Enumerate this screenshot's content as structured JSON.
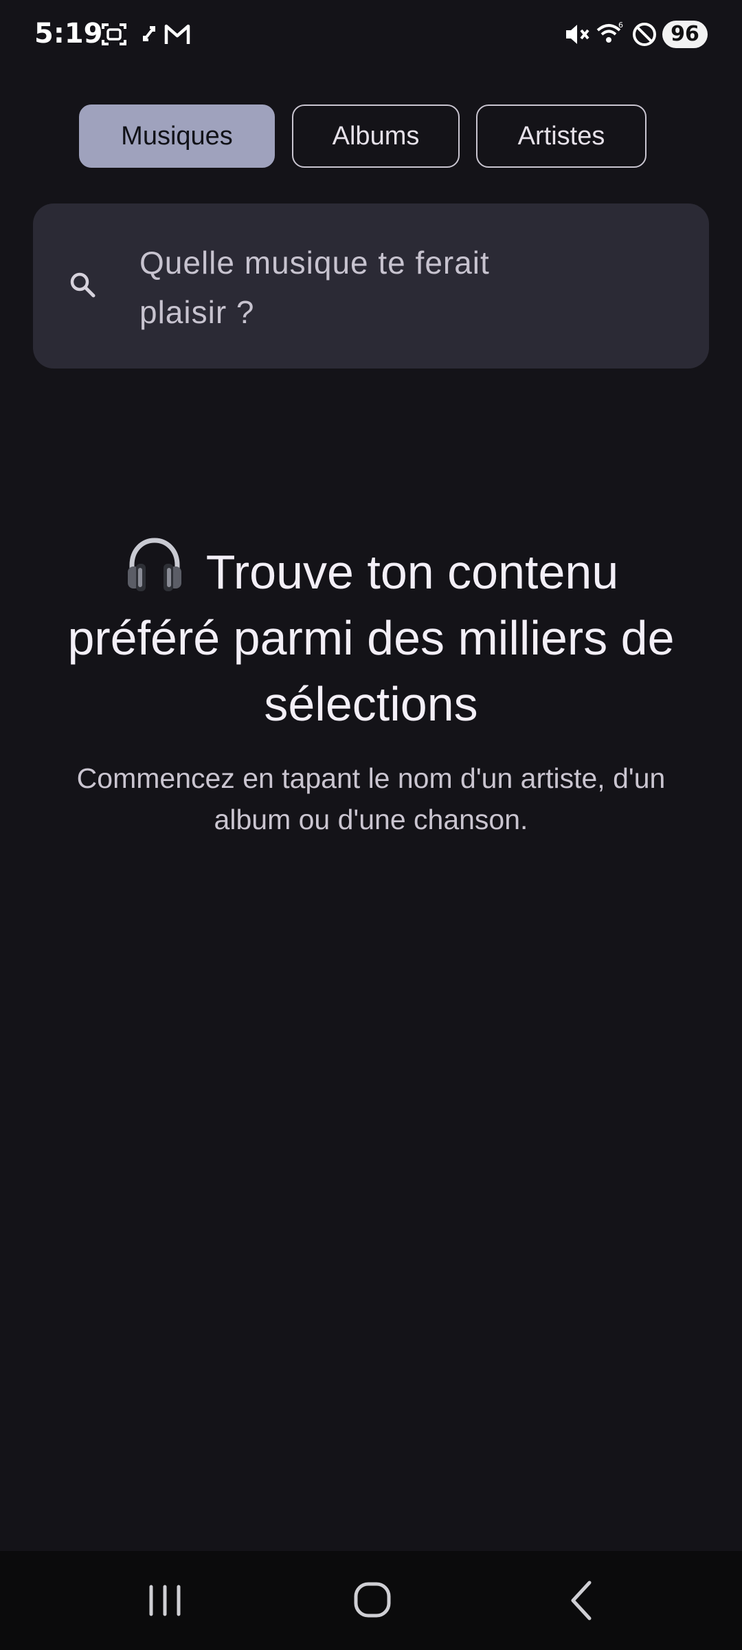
{
  "status_bar": {
    "time": "5:19",
    "battery": "96",
    "icons": [
      "screenshot-icon",
      "sync-icon",
      "gmail-icon",
      "mute-icon",
      "wifi-icon",
      "do-not-disturb-icon"
    ]
  },
  "tabs": [
    {
      "label": "Musiques",
      "active": true
    },
    {
      "label": "Albums",
      "active": false
    },
    {
      "label": "Artistes",
      "active": false
    }
  ],
  "search": {
    "placeholder": "Quelle musique te ferait plaisir ?",
    "icon": "search-icon"
  },
  "empty_state": {
    "icon": "headphones-icon",
    "title": "Trouve ton contenu préféré parmi des milliers de sélections",
    "subtitle": "Commencez en tapant le nom d'un artiste, d'un album ou d'une chanson."
  },
  "nav_bar": {
    "buttons": [
      "recent-apps-icon",
      "home-icon",
      "back-icon"
    ]
  },
  "colors": {
    "background": "#141318",
    "active_tab": "#9fa2bd",
    "search_bg": "#2b2a35"
  }
}
